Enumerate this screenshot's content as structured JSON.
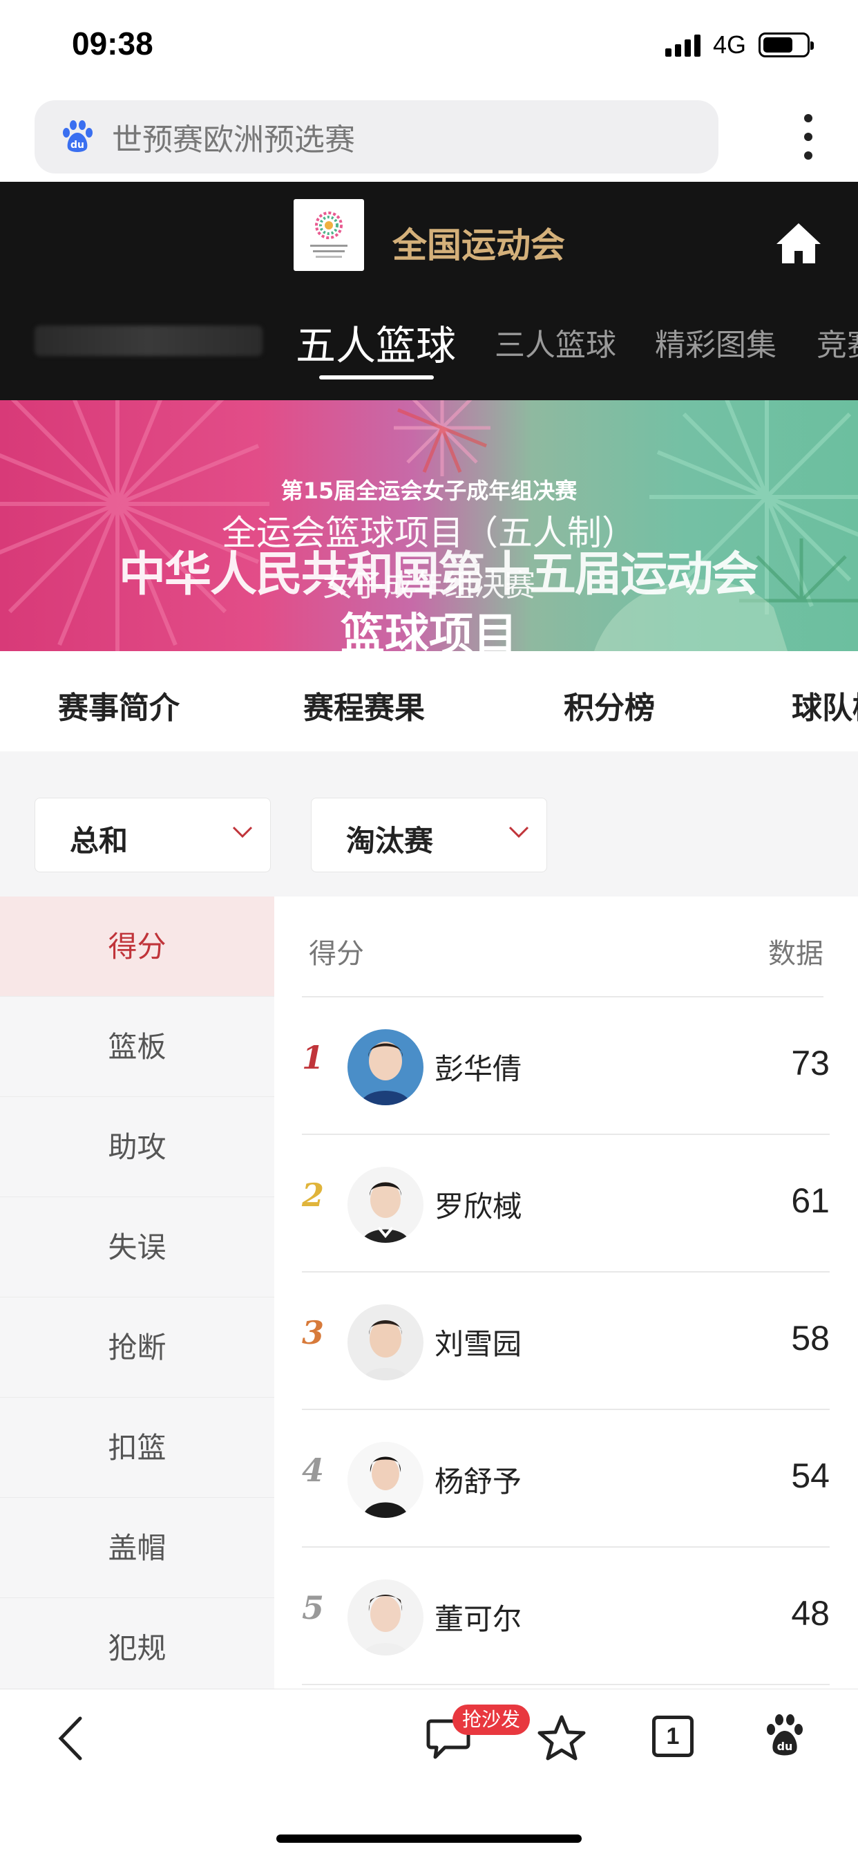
{
  "status_bar": {
    "time": "09:38",
    "network": "4G"
  },
  "search": {
    "query": "世预赛欧洲预选赛"
  },
  "header": {
    "site_title": "全国运动会",
    "nav_tabs": [
      {
        "label": "五人篮球"
      },
      {
        "label": "三人篮球"
      },
      {
        "label": "精彩图集"
      },
      {
        "label": "竞赛"
      }
    ]
  },
  "banner": {
    "line1": "第15届全运会女子成年组决赛",
    "line2": "全运会篮球项目（五人制）",
    "line3": "中华人民共和国第十五届运动会",
    "line4": "女子成年组决赛",
    "line5": "篮球项目"
  },
  "section_tabs": [
    {
      "label": "赛事简介"
    },
    {
      "label": "赛程赛果"
    },
    {
      "label": "积分榜"
    },
    {
      "label": "球队榜"
    }
  ],
  "filters": {
    "scope": "总和",
    "stage": "淘汰赛"
  },
  "categories": [
    {
      "label": "得分"
    },
    {
      "label": "篮板"
    },
    {
      "label": "助攻"
    },
    {
      "label": "失误"
    },
    {
      "label": "抢断"
    },
    {
      "label": "扣篮"
    },
    {
      "label": "盖帽"
    },
    {
      "label": "犯规"
    }
  ],
  "ranking": {
    "header_left": "得分",
    "header_right": "数据",
    "rows": [
      {
        "rank": "1",
        "name": "彭华倩",
        "value": "73"
      },
      {
        "rank": "2",
        "name": "罗欣棫",
        "value": "61"
      },
      {
        "rank": "3",
        "name": "刘雪园",
        "value": "58"
      },
      {
        "rank": "4",
        "name": "杨舒予",
        "value": "54"
      },
      {
        "rank": "5",
        "name": "董可尔",
        "value": "48"
      }
    ]
  },
  "toolbar": {
    "badge": "抢沙发",
    "tab_count": "1"
  },
  "colors": {
    "accent": "#c0343a",
    "header_bg": "#141414",
    "gold": "#d4b07a",
    "rank1": "#c0343a",
    "rank2": "#e0b43a",
    "rank3": "#d77a3a",
    "rank_other": "#999999"
  }
}
